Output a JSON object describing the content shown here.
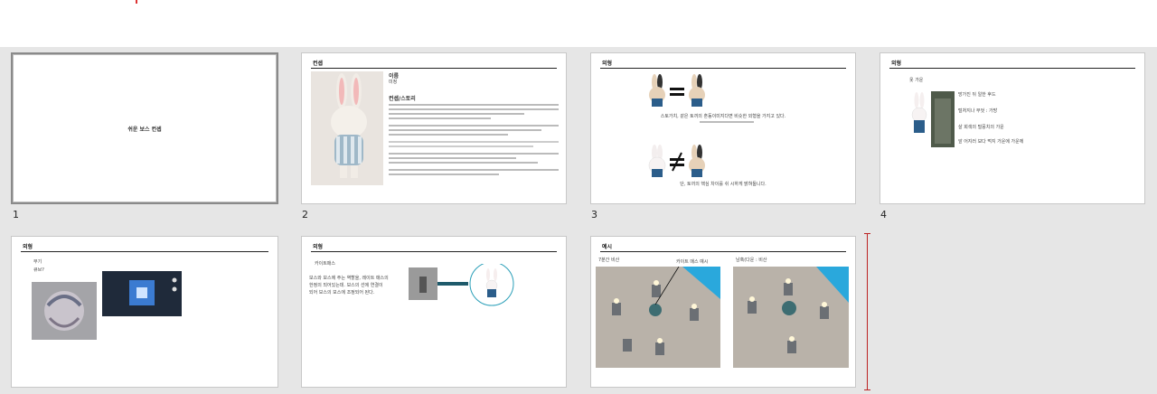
{
  "slides": [
    {
      "number": "1",
      "title": "쉬운 보스 컨셉"
    },
    {
      "number": "2",
      "header": "컨셉",
      "name_label": "이름",
      "name_value": "미정",
      "concept_label": "컨셉/스토리"
    },
    {
      "number": "3",
      "header": "외형",
      "line1": "스토가치, 같은 토끼의 혼동이미지다면 비슷한 외형을 가지고 있다.",
      "line2": "단, 토끼의 핵심 차이를 쉬 시하게 밝혀둡니다."
    },
    {
      "number": "4",
      "header": "외형",
      "sub": "옷 가운",
      "items": [
        "망가진 뒤 일한 후드",
        "털처지나 무엇 : 가방",
        "살 회색의 털뭉치의 가운",
        "앞 어지러 보다 먹지 가운에 가운께"
      ]
    },
    {
      "number": "5",
      "header": "외형",
      "sub1": "무기",
      "sub2": "큐브?"
    },
    {
      "number": "6",
      "header": "외형",
      "sub": "카이트매스",
      "text1": "보스와 보스에 주는 역할을, 레이트 매스의",
      "text2": "한정의 되어있는데. 보스의 선에 연결이",
      "text3": "되어 보스의 보스에 조정되어 된다."
    },
    {
      "number": "7",
      "header": "예시",
      "label_left": "7분간 비산",
      "label_center": "카이트 매스 예시",
      "label_right": "남혹(다운 : 비산"
    }
  ],
  "colors": {
    "accent": "#2a9fb8",
    "selection_border": "#8a8a8a",
    "insert_marker": "#b22222"
  }
}
